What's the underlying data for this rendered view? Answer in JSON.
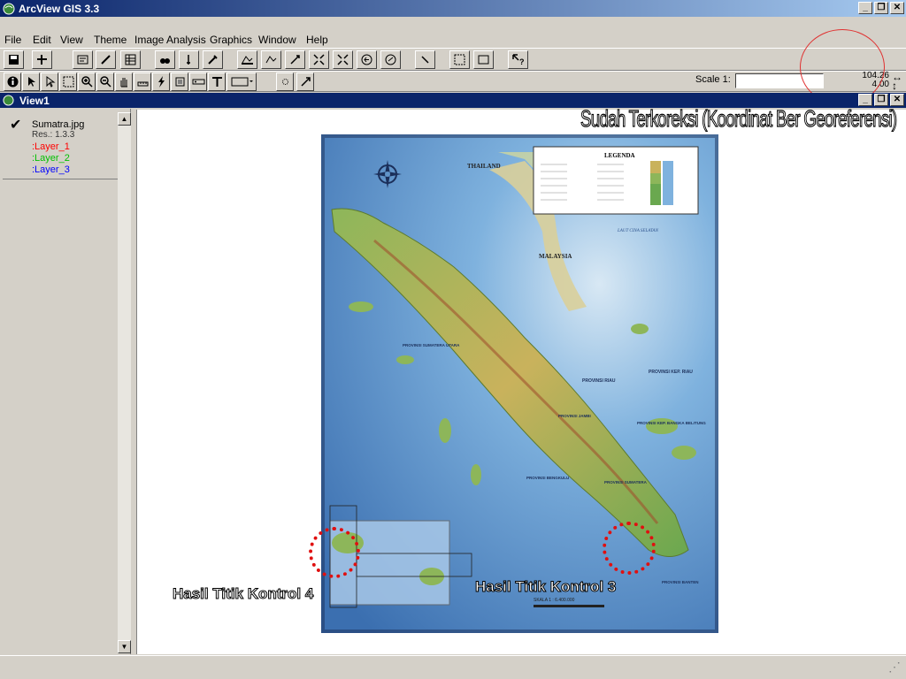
{
  "window": {
    "title": "ArcView GIS 3.3"
  },
  "menu": {
    "items": [
      "File",
      "Edit",
      "View",
      "Theme",
      "Image Analysis",
      "Graphics",
      "Window",
      "Help"
    ]
  },
  "toolbar": {
    "scale_label": "Scale 1:",
    "scale_value": "",
    "coord_x": "104.26",
    "coord_y": "4.00"
  },
  "view": {
    "title": "View1"
  },
  "toc": {
    "theme_name": "Sumatra.jpg",
    "theme_res": "Res.: 1.3.3",
    "layers": [
      {
        "label": ":Layer_1",
        "color": "#ff0000"
      },
      {
        "label": ":Layer_2",
        "color": "#00c000"
      },
      {
        "label": ":Layer_3",
        "color": "#0000ff"
      }
    ]
  },
  "annotations": {
    "headline": "Sudah Terkoreksi (Koordinat Ber Georeferensi)",
    "control_4": "Hasil Titik Kontrol 4",
    "control_3": "Hasil Titik Kontrol 3"
  },
  "map_labels": {
    "legend_title": "LEGENDA",
    "thailand": "THAILAND",
    "malaysia": "MALAYSIA",
    "laut": "LAUT CINA SELATAN",
    "prov_riau": "PROVINSI RIAU",
    "prov_kepriau": "PROVINSI KEP. RIAU",
    "prov_babel": "PROVINSI KEP. BANGKA BELITUNG",
    "prov_jambi": "PROVINSI JAMBI",
    "prov_bengkulu": "PROVINSI BENGKULU",
    "prov_sumsel": "PROVINSI SUMATERA",
    "prov_sumut": "PROVINSI SUMATERA UTARA",
    "prov_banten": "PROVINSI BANTEN",
    "skala": "SKALA 1 : 6.400.000"
  },
  "colors": {
    "title_active": "#0a246a",
    "chrome": "#d4d0c8",
    "sea": "#4a86c8",
    "land": "#6aa84f"
  }
}
